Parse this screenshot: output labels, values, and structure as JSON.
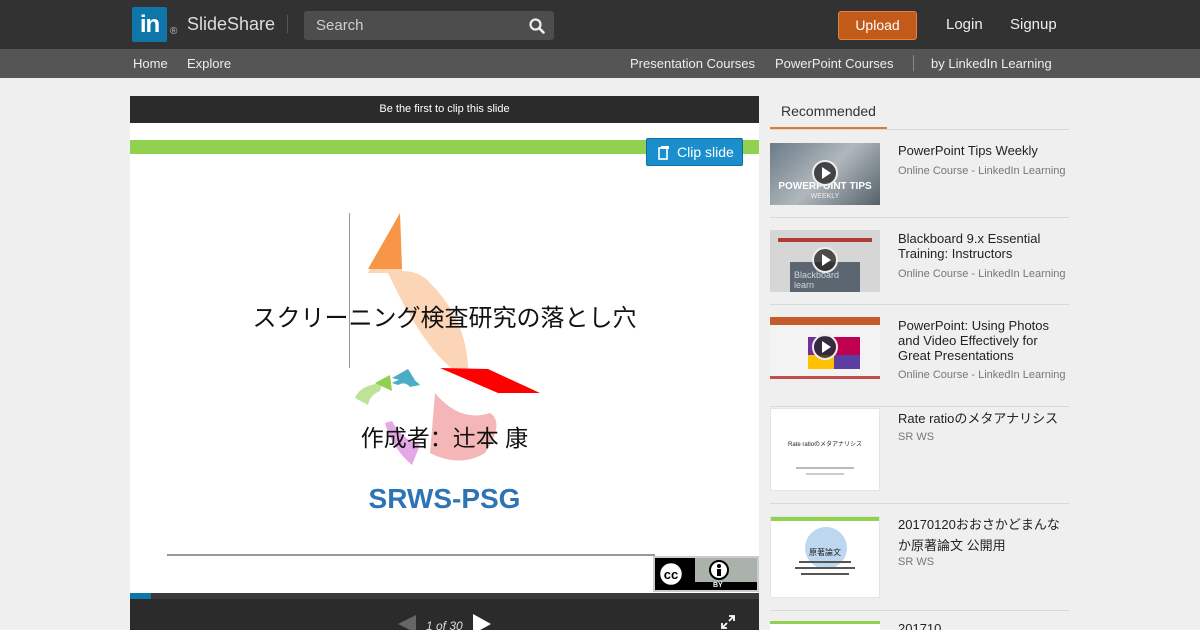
{
  "header": {
    "logo_text": "in",
    "logo_reg": "®",
    "brand": "SlideShare",
    "search_placeholder": "Search",
    "upload_label": "Upload",
    "login_label": "Login",
    "signup_label": "Signup"
  },
  "subnav": {
    "home": "Home",
    "explore": "Explore",
    "presentation_courses": "Presentation Courses",
    "powerpoint_courses": "PowerPoint Courses",
    "by_linkedin": "by LinkedIn Learning"
  },
  "player": {
    "clip_notice": "Be the first to clip this slide",
    "clip_button": "Clip slide",
    "slide_title": "スクリーニング検査研究の落とし穴",
    "slide_author": "作成者：辻本 康",
    "slide_org": "SRWS-PSG",
    "cc_label": "BY",
    "page_count": "1 of 30",
    "progress": 0.033
  },
  "sidebar": {
    "tab_label": "Recommended",
    "items": [
      {
        "title": "PowerPoint Tips Weekly",
        "subtitle": "Online Course - LinkedIn Learning",
        "thumb_text": "POWERPOINT TIPS",
        "thumb_sub": "WEEKLY"
      },
      {
        "title": "Blackboard 9.x Essential Training: Instructors",
        "subtitle": "Online Course - LinkedIn Learning",
        "thumb_text": "Blackboard learn"
      },
      {
        "title": "PowerPoint: Using Photos and Video Effectively for Great Presentations",
        "subtitle": "Online Course - LinkedIn Learning"
      },
      {
        "title": "Rate ratioのメタアナリシス",
        "subtitle": "SR WS",
        "thumb_text": "Rate ratioのメタアナリシス"
      },
      {
        "title": "20170120おおさかどまんなか原著論文 公開用",
        "subtitle": "SR WS",
        "thumb_text": "原著論文"
      },
      {
        "title": "201710...",
        "subtitle": ""
      }
    ]
  },
  "colors": {
    "topbar": "#323232",
    "subnav": "#555555",
    "upload": "#c25b1a",
    "accent_orange": "#e07b2d",
    "clip_blue": "#1a8fcc",
    "slide_green": "#92d050",
    "slide_org_blue": "#2e74b5"
  },
  "icons": {
    "search": "search-icon",
    "clip": "clip-icon",
    "prev": "prev-arrow-icon",
    "next": "next-arrow-icon",
    "fullscreen": "fullscreen-icon",
    "play": "play-icon"
  }
}
